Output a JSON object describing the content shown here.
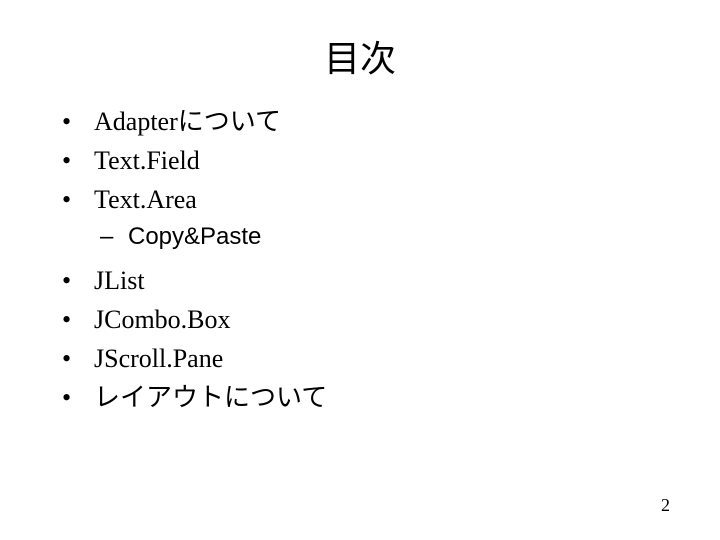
{
  "title": "目次",
  "items": [
    {
      "type": "bullet",
      "text": "Adapterについて"
    },
    {
      "type": "bullet",
      "text": "Text.Field"
    },
    {
      "type": "bullet",
      "text": "Text.Area"
    },
    {
      "type": "sub",
      "text": "Copy&Paste"
    },
    {
      "type": "bullet",
      "text": "JList"
    },
    {
      "type": "bullet",
      "text": "JCombo.Box"
    },
    {
      "type": "bullet",
      "text": "JScroll.Pane"
    },
    {
      "type": "bullet",
      "text": "レイアウトについて"
    }
  ],
  "page_number": "2"
}
